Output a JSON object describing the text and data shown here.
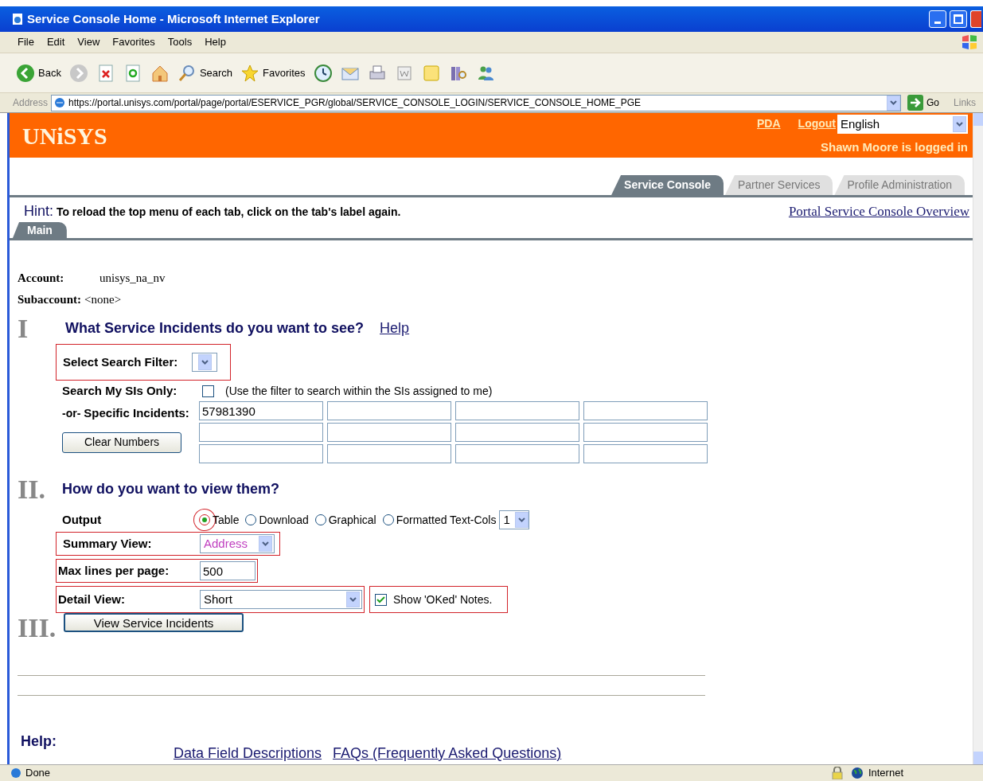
{
  "window": {
    "title": "Service Console Home - Microsoft Internet Explorer"
  },
  "menu": [
    "File",
    "Edit",
    "View",
    "Favorites",
    "Tools",
    "Help"
  ],
  "toolbar": [
    {
      "kind": "back",
      "label": "Back"
    },
    {
      "kind": "forward"
    },
    {
      "kind": "stop"
    },
    {
      "kind": "refresh"
    },
    {
      "kind": "home"
    },
    {
      "kind": "search",
      "label": "Search"
    },
    {
      "kind": "favorites",
      "label": "Favorites"
    },
    {
      "kind": "history"
    },
    {
      "kind": "mail"
    },
    {
      "kind": "print"
    },
    {
      "kind": "word"
    },
    {
      "kind": "note"
    },
    {
      "kind": "research"
    },
    {
      "kind": "messenger"
    }
  ],
  "address_bar": {
    "label": "Address",
    "url": "https://portal.unisys.com/portal/page/portal/ESERVICE_PGR/global/SERVICE_CONSOLE_LOGIN/SERVICE_CONSOLE_HOME_PGE",
    "go": "Go",
    "links": "Links"
  },
  "header": {
    "logo": "UNiSYS",
    "links": [
      "PDA",
      "Logout"
    ],
    "language": "English",
    "user": "Shawn Moore is logged in"
  },
  "tabs": [
    {
      "label": "Service Console",
      "selected": true
    },
    {
      "label": "Partner Services",
      "selected": false
    },
    {
      "label": "Profile Administration",
      "selected": false
    }
  ],
  "hint": {
    "label": "Hint:",
    "text": "To reload the top menu of each tab, click on the tab's label again."
  },
  "overview_link": "Portal Service Console Overview",
  "subtabs": [
    {
      "label": "Main",
      "selected": true
    }
  ],
  "account": {
    "label": "Account:",
    "value": "unisys_na_nv"
  },
  "subaccount": {
    "label": "Subaccount:",
    "value": "<none>"
  },
  "section_1": {
    "numeral": "I",
    "heading": "What Service Incidents do you want to see?",
    "help": "Help",
    "filter_label": "Select Search Filter:",
    "my_sis_label": "Search My SIs Only:",
    "my_sis_checked": false,
    "my_sis_note": "(Use the filter to search within the SIs assigned to me)",
    "or": "-or-",
    "incidents_label": "Specific Incidents:",
    "incident_value": "57981390",
    "clear_button": "Clear Numbers"
  },
  "section_2": {
    "numeral": "II.",
    "heading": "How do you want to view them?",
    "output_label": "Output",
    "output_options": [
      {
        "label": "Table",
        "selected": true
      },
      {
        "label": "Download",
        "selected": false
      },
      {
        "label": "Graphical",
        "selected": false
      },
      {
        "label": "Formatted Text-Cols",
        "selected": false
      }
    ],
    "cols": "1",
    "summary_label": "Summary View:",
    "summary_value": "Address",
    "max_label": "Max lines per page:",
    "max_value": "500",
    "detail_label": "Detail View:",
    "detail_value": "Short",
    "oked_label": "Show 'OKed' Notes.",
    "oked_checked": true
  },
  "section_3": {
    "numeral": "III.",
    "button": "View Service Incidents"
  },
  "help": {
    "label": "Help:",
    "links": [
      "Data Field Descriptions",
      "FAQs (Frequently Asked Questions)"
    ]
  },
  "status_bar": {
    "text": "Done",
    "zone": "Internet"
  }
}
